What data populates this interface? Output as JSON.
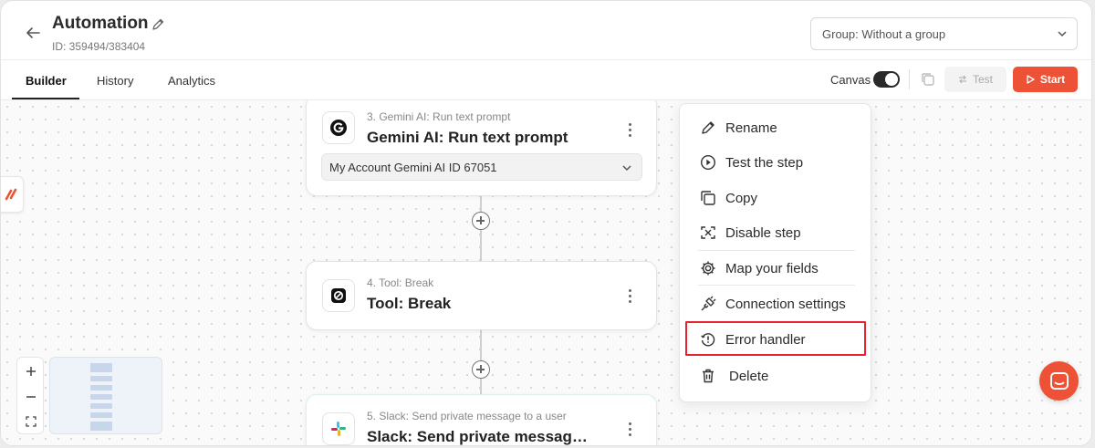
{
  "header": {
    "title": "Automation",
    "id_text": "ID: 359494/383404",
    "group_select_value": "Group: Without a group"
  },
  "tabs": [
    {
      "label": "Builder",
      "active": true
    },
    {
      "label": "History",
      "active": false
    },
    {
      "label": "Analytics",
      "active": false
    }
  ],
  "toolbar": {
    "canvas_label": "Canvas",
    "canvas_enabled": true,
    "test_label": "Test",
    "start_label": "Start",
    "accent_color": "#ee5236"
  },
  "steps": [
    {
      "label": "3. Gemini AI: Run text prompt",
      "title": "Gemini AI: Run text prompt",
      "icon": "gemini-icon",
      "account": "My Account Gemini AI ID 67051"
    },
    {
      "label": "4. Tool: Break",
      "title": "Tool: Break",
      "icon": "break-icon"
    },
    {
      "label": "5. Slack: Send private message to a user",
      "title": "Slack: Send private messag…",
      "icon": "slack-icon"
    }
  ],
  "context_menu": {
    "items": [
      {
        "label": "Rename",
        "icon": "pencil-icon"
      },
      {
        "label": "Test the step",
        "icon": "play-circle-icon"
      },
      {
        "label": "Copy",
        "icon": "copy-icon"
      },
      {
        "label": "Disable step",
        "icon": "disable-icon"
      },
      {
        "label": "Map your fields",
        "icon": "gear-icon"
      },
      {
        "label": "Connection settings",
        "icon": "plug-icon"
      },
      {
        "label": "Error handler",
        "icon": "error-handler-icon",
        "highlighted": true
      },
      {
        "label": "Delete",
        "icon": "trash-icon"
      }
    ],
    "highlight_color": "#e8232f"
  }
}
